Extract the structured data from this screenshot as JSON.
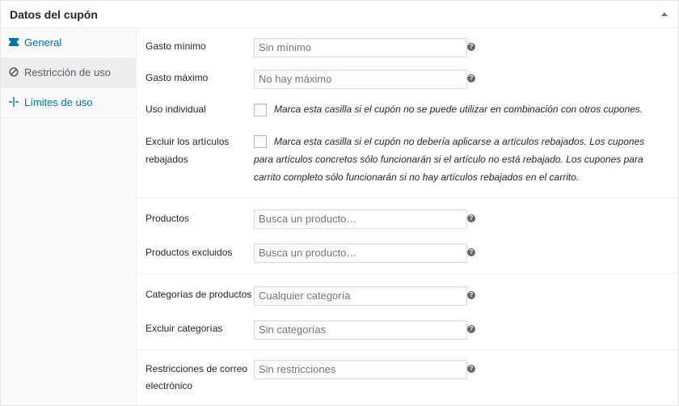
{
  "header": {
    "title": "Datos del cupón"
  },
  "tabs": [
    {
      "label": "General",
      "icon": "ticket-icon"
    },
    {
      "label": "Restricción de uso",
      "icon": "block-icon"
    },
    {
      "label": "Límites de uso",
      "icon": "limits-icon"
    }
  ],
  "fields": {
    "minimum_spend": {
      "label": "Gasto mínimo",
      "placeholder": "Sin mínimo"
    },
    "maximum_spend": {
      "label": "Gasto máximo",
      "placeholder": "No hay máximo"
    },
    "individual_use": {
      "label": "Uso individual",
      "description": "Marca esta casilla si el cupón no se puede utilizar en combinación con otros cupones."
    },
    "exclude_sale_items": {
      "label_line1": "Excluir los artículos",
      "label_line2": "rebajados",
      "desc_line1": "Marca esta casilla si el cupón no debería aplicarse a artículos rebajados. Los cupones",
      "desc_line2": "para artículos concretos sólo funcionarán si el artículo no está rebajado. Los cupones para",
      "desc_line3": "carrito completo sólo funcionarán si no hay artículos rebajados en el carrito."
    },
    "products": {
      "label": "Productos",
      "placeholder": "Busca un producto…"
    },
    "exclude_products": {
      "label": "Productos excluidos",
      "placeholder": "Busca un producto…"
    },
    "product_categories": {
      "label": "Categorías de productos",
      "placeholder": "Cualquier categoría"
    },
    "exclude_categories": {
      "label": "Excluir categorías",
      "placeholder": "Sin categorías"
    },
    "email_restrictions": {
      "label_line1": "Restricciones de correo",
      "label_line2": "electrónico",
      "placeholder": "Sin restricciones"
    }
  },
  "help_tip_glyph": "?",
  "colors": {
    "link": "#0073aa",
    "tab_active_bg": "#eeeeee",
    "sidebar_bg": "#fafafa",
    "help_tip": "#666666"
  }
}
